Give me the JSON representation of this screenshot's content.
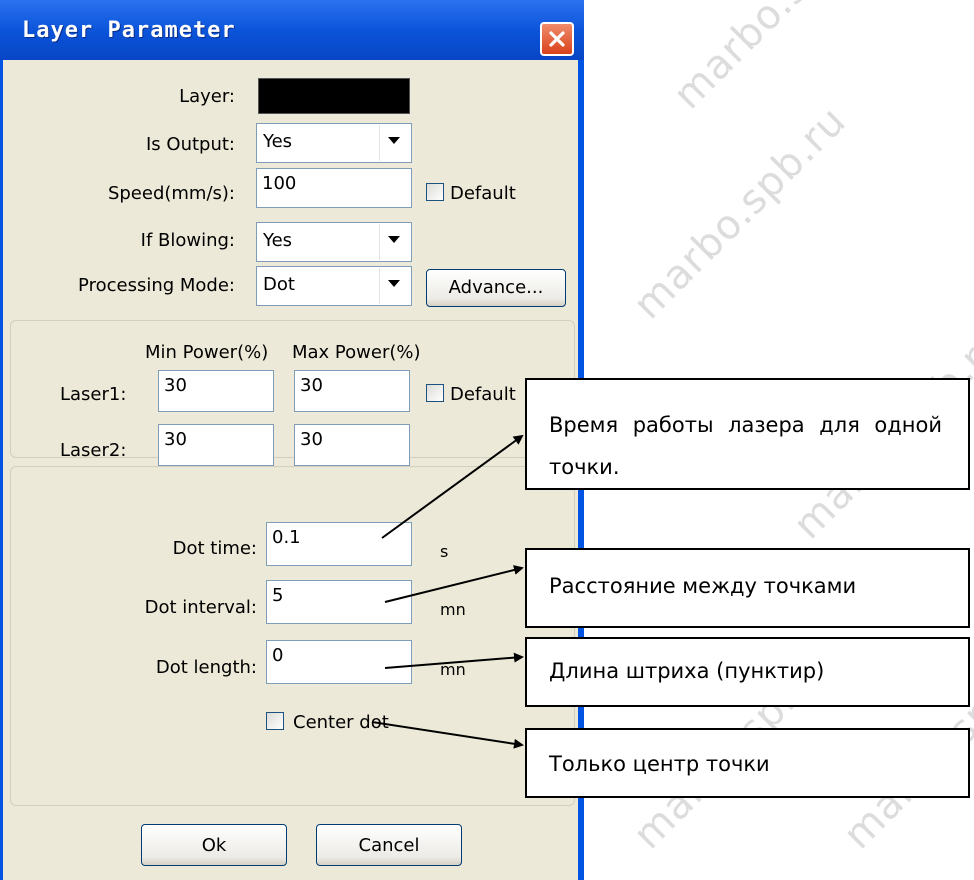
{
  "watermark_text": "marbo.spb.ru",
  "dialog": {
    "title": "Layer Parameter",
    "layer_label": "Layer:",
    "layer_color": "#000000",
    "is_output_label": "Is Output:",
    "is_output_value": "Yes",
    "speed_label": "Speed(mm/s):",
    "speed_value": "100",
    "speed_default_label": "Default",
    "blowing_label": "If Blowing:",
    "blowing_value": "Yes",
    "mode_label": "Processing Mode:",
    "mode_value": "Dot",
    "advance_label": "Advance...",
    "power": {
      "min_header": "Min Power(%)",
      "max_header": "Max Power(%)",
      "laser1_label": "Laser1:",
      "laser1_min": "30",
      "laser1_max": "30",
      "default_label": "Default",
      "laser2_label": "Laser2:",
      "laser2_min": "30",
      "laser2_max": "30"
    },
    "dot": {
      "time_label": "Dot time:",
      "time_value": "0.1",
      "time_unit": "s",
      "interval_label": "Dot interval:",
      "interval_value": "5",
      "interval_unit": "mn",
      "length_label": "Dot length:",
      "length_value": "0",
      "length_unit": "mn",
      "center_label": "Center dot"
    },
    "ok_label": "Ok",
    "cancel_label": "Cancel"
  },
  "callouts": {
    "dot_time": "Время работы лазера для одной точки.",
    "dot_interval": "Расстояние между точками",
    "dot_length": "Длина штриха (пунктир)",
    "center_dot": "Только центр точки"
  },
  "colors": {
    "titlebar": "#0a52d8",
    "dialog_bg": "#ece9d8",
    "close_button": "#d9411b"
  }
}
